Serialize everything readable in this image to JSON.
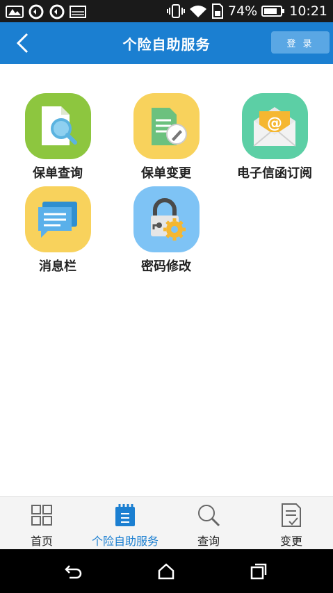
{
  "status_bar": {
    "battery": "74%",
    "time": "10:21",
    "icons": [
      "photo-icon",
      "sync-icon",
      "sync-icon",
      "image-icon",
      "vibrate-icon",
      "wifi-icon",
      "sim-icon",
      "battery-icon"
    ]
  },
  "header": {
    "title": "个险自助服务",
    "login_label": "登 录",
    "back_icon": "chevron-left-icon",
    "color": "#1b7fd1"
  },
  "tiles": [
    {
      "label": "保单查询",
      "icon": "document-search-icon",
      "bg": "#8dc63f"
    },
    {
      "label": "保单变更",
      "icon": "document-edit-icon",
      "bg": "#f8d25c"
    },
    {
      "label": "电子信函订阅",
      "icon": "email-icon",
      "bg": "#5ccfa5"
    },
    {
      "label": "消息栏",
      "icon": "message-icon",
      "bg": "#f8d25c"
    },
    {
      "label": "密码修改",
      "icon": "lock-gear-icon",
      "bg": "#7ec3f5"
    }
  ],
  "bottom_nav": [
    {
      "label": "首页",
      "icon": "grid-icon",
      "active": false
    },
    {
      "label": "个险自助服务",
      "icon": "notepad-icon",
      "active": true
    },
    {
      "label": "查询",
      "icon": "search-icon",
      "active": false
    },
    {
      "label": "变更",
      "icon": "document-check-icon",
      "active": false
    }
  ],
  "system_nav": [
    "back-icon",
    "home-icon",
    "recents-icon"
  ]
}
